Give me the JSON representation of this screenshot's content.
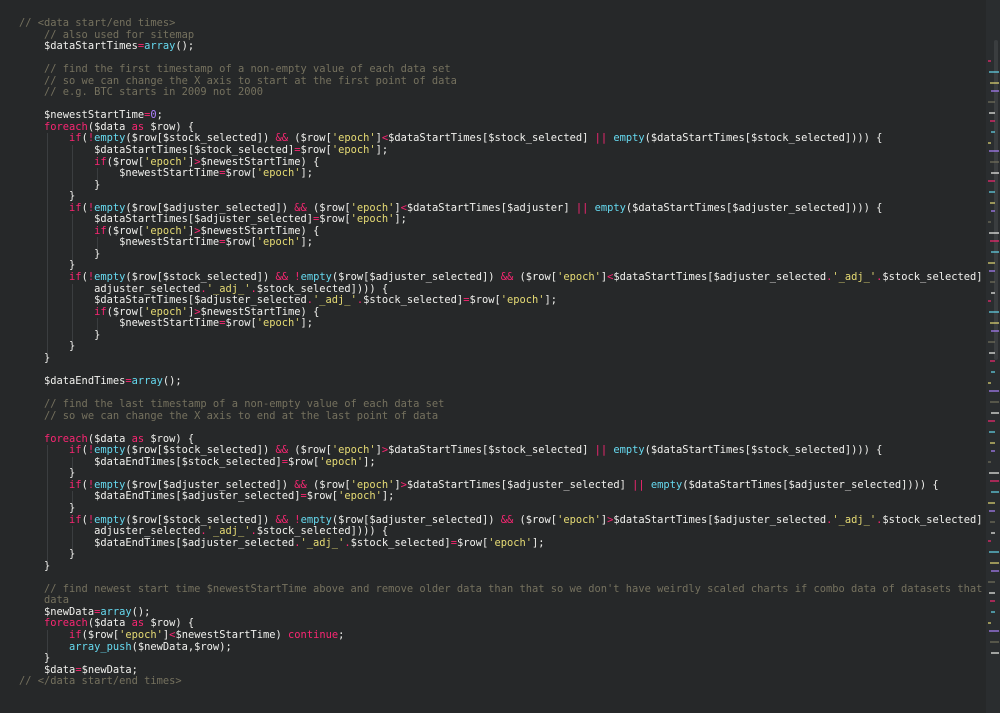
{
  "editor": {
    "lines": [
      [
        [
          "cm",
          "// <data start/end times>"
        ]
      ],
      [
        [
          "cm",
          "    // also used for sitemap"
        ]
      ],
      [
        [
          "tx",
          "    $dataStartTimes"
        ],
        [
          "op",
          "="
        ],
        [
          "fn",
          "array"
        ],
        [
          "tx",
          "();"
        ]
      ],
      [],
      [
        [
          "cm",
          "    // find the first timestamp of a non-empty value of each data set"
        ]
      ],
      [
        [
          "cm",
          "    // so we can change the X axis to start at the first point of data"
        ]
      ],
      [
        [
          "cm",
          "    // e.g. BTC starts in 2009 not 2000"
        ]
      ],
      [],
      [
        [
          "tx",
          "    $newestStartTime"
        ],
        [
          "op",
          "="
        ],
        [
          "num",
          "0"
        ],
        [
          "tx",
          ";"
        ]
      ],
      [
        [
          "kw",
          "    foreach"
        ],
        [
          "tx",
          "($data "
        ],
        [
          "kw",
          "as"
        ],
        [
          "tx",
          " $row) {"
        ]
      ],
      [
        [
          "kw",
          "        if"
        ],
        [
          "tx",
          "("
        ],
        [
          "op",
          "!"
        ],
        [
          "fn",
          "empty"
        ],
        [
          "tx",
          "($row[$stock_selected]) "
        ],
        [
          "op",
          "&&"
        ],
        [
          "tx",
          " ($row["
        ],
        [
          "str",
          "'epoch'"
        ],
        [
          "tx",
          "]"
        ],
        [
          "op",
          "<"
        ],
        [
          "tx",
          "$dataStartTimes[$stock_selected] "
        ],
        [
          "op",
          "||"
        ],
        [
          "tx",
          " "
        ],
        [
          "fn",
          "empty"
        ],
        [
          "tx",
          "($dataStartTimes[$stock_selected]))) {"
        ]
      ],
      [
        [
          "tx",
          "            $dataStartTimes[$stock_selected]"
        ],
        [
          "op",
          "="
        ],
        [
          "tx",
          "$row["
        ],
        [
          "str",
          "'epoch'"
        ],
        [
          "tx",
          "];"
        ]
      ],
      [
        [
          "kw",
          "            if"
        ],
        [
          "tx",
          "($row["
        ],
        [
          "str",
          "'epoch'"
        ],
        [
          "tx",
          "]"
        ],
        [
          "op",
          ">"
        ],
        [
          "tx",
          "$newestStartTime) {"
        ]
      ],
      [
        [
          "tx",
          "                $newestStartTime"
        ],
        [
          "op",
          "="
        ],
        [
          "tx",
          "$row["
        ],
        [
          "str",
          "'epoch'"
        ],
        [
          "tx",
          "];"
        ]
      ],
      [
        [
          "tx",
          "            }"
        ]
      ],
      [
        [
          "tx",
          "        }"
        ]
      ],
      [
        [
          "kw",
          "        if"
        ],
        [
          "tx",
          "("
        ],
        [
          "op",
          "!"
        ],
        [
          "fn",
          "empty"
        ],
        [
          "tx",
          "($row[$adjuster_selected]) "
        ],
        [
          "op",
          "&&"
        ],
        [
          "tx",
          " ($row["
        ],
        [
          "str",
          "'epoch'"
        ],
        [
          "tx",
          "]"
        ],
        [
          "op",
          "<"
        ],
        [
          "tx",
          "$dataStartTimes[$adjuster] "
        ],
        [
          "op",
          "||"
        ],
        [
          "tx",
          " "
        ],
        [
          "fn",
          "empty"
        ],
        [
          "tx",
          "($dataStartTimes[$adjuster_selected]))) {"
        ]
      ],
      [
        [
          "tx",
          "            $dataStartTimes[$adjuster_selected]"
        ],
        [
          "op",
          "="
        ],
        [
          "tx",
          "$row["
        ],
        [
          "str",
          "'epoch'"
        ],
        [
          "tx",
          "];"
        ]
      ],
      [
        [
          "kw",
          "            if"
        ],
        [
          "tx",
          "($row["
        ],
        [
          "str",
          "'epoch'"
        ],
        [
          "tx",
          "]"
        ],
        [
          "op",
          ">"
        ],
        [
          "tx",
          "$newestStartTime) {"
        ]
      ],
      [
        [
          "tx",
          "                $newestStartTime"
        ],
        [
          "op",
          "="
        ],
        [
          "tx",
          "$row["
        ],
        [
          "str",
          "'epoch'"
        ],
        [
          "tx",
          "];"
        ]
      ],
      [
        [
          "tx",
          "            }"
        ]
      ],
      [
        [
          "tx",
          "        }"
        ]
      ],
      [
        [
          "kw",
          "        if"
        ],
        [
          "tx",
          "("
        ],
        [
          "op",
          "!"
        ],
        [
          "fn",
          "empty"
        ],
        [
          "tx",
          "($row[$stock_selected]) "
        ],
        [
          "op",
          "&&"
        ],
        [
          "tx",
          " "
        ],
        [
          "op",
          "!"
        ],
        [
          "fn",
          "empty"
        ],
        [
          "tx",
          "($row[$adjuster_selected]) "
        ],
        [
          "op",
          "&&"
        ],
        [
          "tx",
          " ($row["
        ],
        [
          "str",
          "'epoch'"
        ],
        [
          "tx",
          "]"
        ],
        [
          "op",
          "<"
        ],
        [
          "tx",
          "$dataStartTimes[$adjuster_selected"
        ],
        [
          "op",
          "."
        ],
        [
          "str",
          "'_adj_'"
        ],
        [
          "op",
          "."
        ],
        [
          "tx",
          "$stock_selected] "
        ],
        [
          "op",
          "||"
        ],
        [
          "tx",
          " "
        ],
        [
          "fn",
          "empty"
        ],
        [
          "tx",
          "($dataStartTimes[$"
        ]
      ],
      [
        [
          "tx",
          "            adjuster_selected"
        ],
        [
          "op",
          "."
        ],
        [
          "str",
          "'_adj_'"
        ],
        [
          "op",
          "."
        ],
        [
          "tx",
          "$stock_selected]))) {"
        ]
      ],
      [
        [
          "tx",
          "            $dataStartTimes[$adjuster_selected"
        ],
        [
          "op",
          "."
        ],
        [
          "str",
          "'_adj_'"
        ],
        [
          "op",
          "."
        ],
        [
          "tx",
          "$stock_selected]"
        ],
        [
          "op",
          "="
        ],
        [
          "tx",
          "$row["
        ],
        [
          "str",
          "'epoch'"
        ],
        [
          "tx",
          "];"
        ]
      ],
      [
        [
          "kw",
          "            if"
        ],
        [
          "tx",
          "($row["
        ],
        [
          "str",
          "'epoch'"
        ],
        [
          "tx",
          "]"
        ],
        [
          "op",
          ">"
        ],
        [
          "tx",
          "$newestStartTime) {"
        ]
      ],
      [
        [
          "tx",
          "                $newestStartTime"
        ],
        [
          "op",
          "="
        ],
        [
          "tx",
          "$row["
        ],
        [
          "str",
          "'epoch'"
        ],
        [
          "tx",
          "];"
        ]
      ],
      [
        [
          "tx",
          "            }"
        ]
      ],
      [
        [
          "tx",
          "        }"
        ]
      ],
      [
        [
          "tx",
          "    }"
        ]
      ],
      [],
      [
        [
          "tx",
          "    $dataEndTimes"
        ],
        [
          "op",
          "="
        ],
        [
          "fn",
          "array"
        ],
        [
          "tx",
          "();"
        ]
      ],
      [],
      [
        [
          "cm",
          "    // find the last timestamp of a non-empty value of each data set"
        ]
      ],
      [
        [
          "cm",
          "    // so we can change the X axis to end at the last point of data"
        ]
      ],
      [],
      [
        [
          "kw",
          "    foreach"
        ],
        [
          "tx",
          "($data "
        ],
        [
          "kw",
          "as"
        ],
        [
          "tx",
          " $row) {"
        ]
      ],
      [
        [
          "kw",
          "        if"
        ],
        [
          "tx",
          "("
        ],
        [
          "op",
          "!"
        ],
        [
          "fn",
          "empty"
        ],
        [
          "tx",
          "($row[$stock_selected]) "
        ],
        [
          "op",
          "&&"
        ],
        [
          "tx",
          " ($row["
        ],
        [
          "str",
          "'epoch'"
        ],
        [
          "tx",
          "]"
        ],
        [
          "op",
          ">"
        ],
        [
          "tx",
          "$dataStartTimes[$stock_selected] "
        ],
        [
          "op",
          "||"
        ],
        [
          "tx",
          " "
        ],
        [
          "fn",
          "empty"
        ],
        [
          "tx",
          "($dataStartTimes[$stock_selected]))) {"
        ]
      ],
      [
        [
          "tx",
          "            $dataEndTimes[$stock_selected]"
        ],
        [
          "op",
          "="
        ],
        [
          "tx",
          "$row["
        ],
        [
          "str",
          "'epoch'"
        ],
        [
          "tx",
          "];"
        ]
      ],
      [
        [
          "tx",
          "        }"
        ]
      ],
      [
        [
          "kw",
          "        if"
        ],
        [
          "tx",
          "("
        ],
        [
          "op",
          "!"
        ],
        [
          "fn",
          "empty"
        ],
        [
          "tx",
          "($row[$adjuster_selected]) "
        ],
        [
          "op",
          "&&"
        ],
        [
          "tx",
          " ($row["
        ],
        [
          "str",
          "'epoch'"
        ],
        [
          "tx",
          "]"
        ],
        [
          "op",
          ">"
        ],
        [
          "tx",
          "$dataStartTimes[$adjuster_selected] "
        ],
        [
          "op",
          "||"
        ],
        [
          "tx",
          " "
        ],
        [
          "fn",
          "empty"
        ],
        [
          "tx",
          "($dataStartTimes[$adjuster_selected]))) {"
        ]
      ],
      [
        [
          "tx",
          "            $dataEndTimes[$adjuster_selected]"
        ],
        [
          "op",
          "="
        ],
        [
          "tx",
          "$row["
        ],
        [
          "str",
          "'epoch'"
        ],
        [
          "tx",
          "];"
        ]
      ],
      [
        [
          "tx",
          "        }"
        ]
      ],
      [
        [
          "kw",
          "        if"
        ],
        [
          "tx",
          "("
        ],
        [
          "op",
          "!"
        ],
        [
          "fn",
          "empty"
        ],
        [
          "tx",
          "($row[$stock_selected]) "
        ],
        [
          "op",
          "&&"
        ],
        [
          "tx",
          " "
        ],
        [
          "op",
          "!"
        ],
        [
          "fn",
          "empty"
        ],
        [
          "tx",
          "($row[$adjuster_selected]) "
        ],
        [
          "op",
          "&&"
        ],
        [
          "tx",
          " ($row["
        ],
        [
          "str",
          "'epoch'"
        ],
        [
          "tx",
          "]"
        ],
        [
          "op",
          ">"
        ],
        [
          "tx",
          "$dataStartTimes[$adjuster_selected"
        ],
        [
          "op",
          "."
        ],
        [
          "str",
          "'_adj_'"
        ],
        [
          "op",
          "."
        ],
        [
          "tx",
          "$stock_selected] "
        ],
        [
          "op",
          "||"
        ],
        [
          "tx",
          " "
        ],
        [
          "fn",
          "empty"
        ],
        [
          "tx",
          "($dataStartTimes[$"
        ]
      ],
      [
        [
          "tx",
          "            adjuster_selected"
        ],
        [
          "op",
          "."
        ],
        [
          "str",
          "'_adj_'"
        ],
        [
          "op",
          "."
        ],
        [
          "tx",
          "$stock_selected]))) {"
        ]
      ],
      [
        [
          "tx",
          "            $dataEndTimes[$adjuster_selected"
        ],
        [
          "op",
          "."
        ],
        [
          "str",
          "'_adj_'"
        ],
        [
          "op",
          "."
        ],
        [
          "tx",
          "$stock_selected]"
        ],
        [
          "op",
          "="
        ],
        [
          "tx",
          "$row["
        ],
        [
          "str",
          "'epoch'"
        ],
        [
          "tx",
          "];"
        ]
      ],
      [
        [
          "tx",
          "        }"
        ]
      ],
      [
        [
          "tx",
          "    }"
        ]
      ],
      [],
      [
        [
          "cm",
          "    // find newest start time $newestStartTime above and remove older data than that so we don't have weirdly scaled charts if combo data of datasets that have lots of data and few"
        ]
      ],
      [
        [
          "cm",
          "    data"
        ]
      ],
      [
        [
          "tx",
          "    $newData"
        ],
        [
          "op",
          "="
        ],
        [
          "fn",
          "array"
        ],
        [
          "tx",
          "();"
        ]
      ],
      [
        [
          "kw",
          "    foreach"
        ],
        [
          "tx",
          "($data "
        ],
        [
          "kw",
          "as"
        ],
        [
          "tx",
          " $row) {"
        ]
      ],
      [
        [
          "kw",
          "        if"
        ],
        [
          "tx",
          "($row["
        ],
        [
          "str",
          "'epoch'"
        ],
        [
          "tx",
          "]"
        ],
        [
          "op",
          "<"
        ],
        [
          "tx",
          "$newestStartTime) "
        ],
        [
          "kw",
          "continue"
        ],
        [
          "tx",
          ";"
        ]
      ],
      [
        [
          "fn",
          "        array_push"
        ],
        [
          "tx",
          "($newData,$row);"
        ]
      ],
      [
        [
          "tx",
          "    }"
        ]
      ],
      [
        [
          "tx",
          "    $data"
        ],
        [
          "op",
          "="
        ],
        [
          "tx",
          "$newData;"
        ]
      ],
      [
        [
          "cm",
          "// </data start/end times>"
        ]
      ]
    ]
  },
  "minimap": {
    "label": "minimap",
    "colors": [
      "#f92672",
      "#66d9ef",
      "#e6db74",
      "#ae81ff",
      "#75715e",
      "#f1f1ee"
    ]
  }
}
